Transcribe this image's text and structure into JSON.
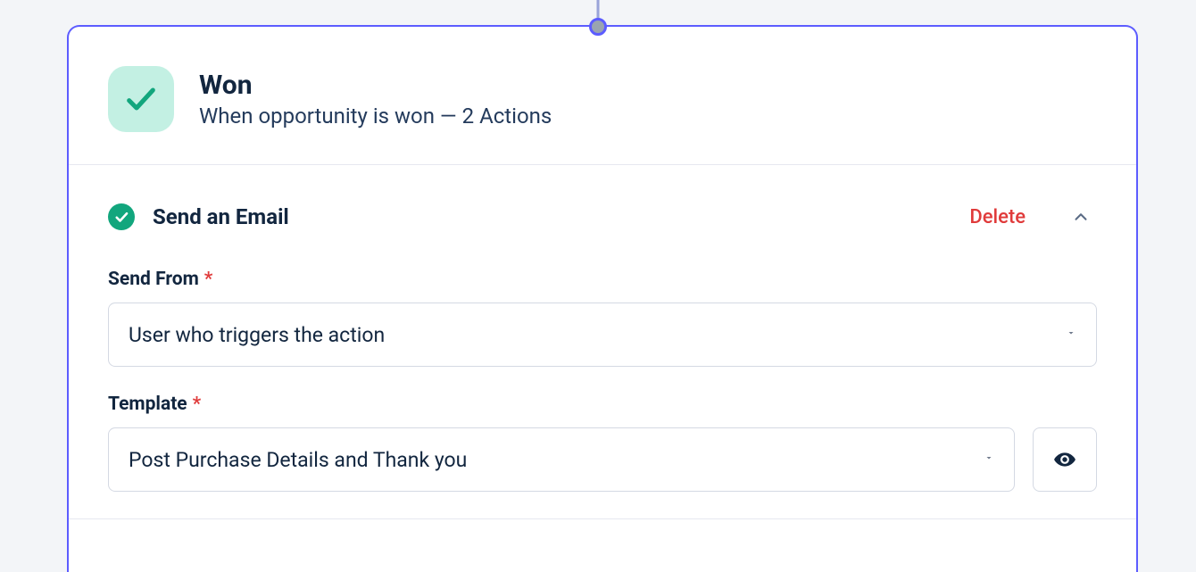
{
  "header": {
    "title": "Won",
    "subtitle": "When opportunity is won — 2 Actions"
  },
  "action": {
    "title": "Send an Email",
    "delete_label": "Delete",
    "fields": {
      "send_from": {
        "label": "Send From",
        "value": "User who triggers the action"
      },
      "template": {
        "label": "Template",
        "value": "Post Purchase Details and Thank you"
      }
    }
  }
}
